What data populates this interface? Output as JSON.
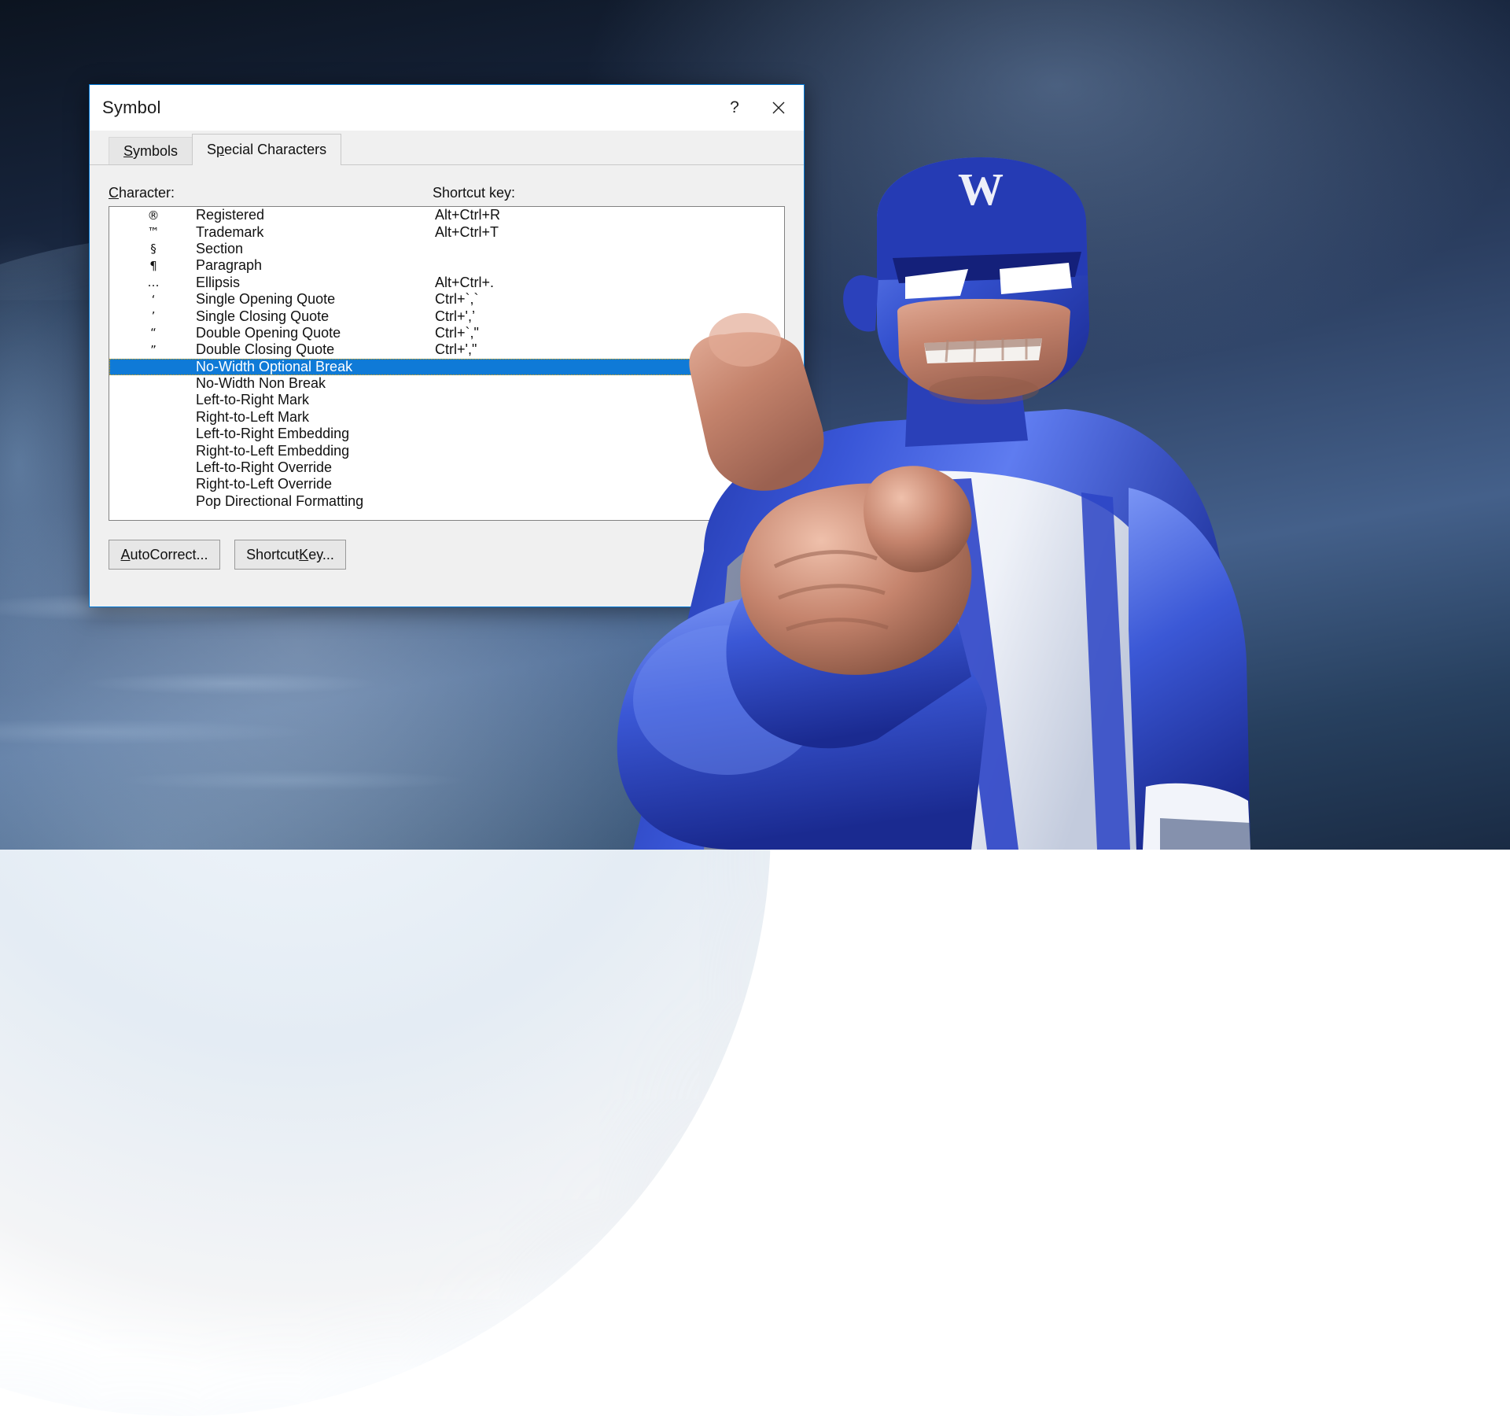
{
  "window": {
    "title": "Symbol",
    "help_label": "?",
    "close_label": "✕"
  },
  "tabs": [
    {
      "id": "symbols",
      "label": "Symbols",
      "accel": "S",
      "active": false
    },
    {
      "id": "special-characters",
      "label": "Special Characters",
      "accel": "p",
      "active": true
    }
  ],
  "headers": {
    "character": "Character:",
    "character_accel": "C",
    "shortcut_key": "Shortcut key:"
  },
  "list": {
    "selected_index": 9,
    "rows": [
      {
        "symbol": "®",
        "name": "Registered",
        "shortcut": "Alt+Ctrl+R"
      },
      {
        "symbol": "™",
        "name": "Trademark",
        "shortcut": "Alt+Ctrl+T"
      },
      {
        "symbol": "§",
        "name": "Section",
        "shortcut": ""
      },
      {
        "symbol": "¶",
        "name": "Paragraph",
        "shortcut": ""
      },
      {
        "symbol": "…",
        "name": "Ellipsis",
        "shortcut": "Alt+Ctrl+."
      },
      {
        "symbol": "‘",
        "name": "Single Opening Quote",
        "shortcut": "Ctrl+`,`"
      },
      {
        "symbol": "’",
        "name": "Single Closing Quote",
        "shortcut": "Ctrl+',’"
      },
      {
        "symbol": "“",
        "name": "Double Opening Quote",
        "shortcut": "Ctrl+`,\""
      },
      {
        "symbol": "”",
        "name": "Double Closing Quote",
        "shortcut": "Ctrl+',\""
      },
      {
        "symbol": "",
        "name": "No-Width Optional Break",
        "shortcut": ""
      },
      {
        "symbol": "",
        "name": "No-Width Non Break",
        "shortcut": ""
      },
      {
        "symbol": "",
        "name": "Left-to-Right Mark",
        "shortcut": ""
      },
      {
        "symbol": "",
        "name": "Right-to-Left Mark",
        "shortcut": ""
      },
      {
        "symbol": "",
        "name": "Left-to-Right Embedding",
        "shortcut": ""
      },
      {
        "symbol": "",
        "name": "Right-to-Left Embedding",
        "shortcut": ""
      },
      {
        "symbol": "",
        "name": "Left-to-Right Override",
        "shortcut": ""
      },
      {
        "symbol": "",
        "name": "Right-to-Left Override",
        "shortcut": ""
      },
      {
        "symbol": "",
        "name": "Pop Directional Formatting",
        "shortcut": ""
      }
    ]
  },
  "buttons": [
    {
      "id": "autocorrect",
      "label": "AutoCorrect...",
      "accel": "A"
    },
    {
      "id": "shortcut-key",
      "label": "Shortcut Key...",
      "accel": "K"
    }
  ],
  "mascot": {
    "logo_letter": "W"
  },
  "colors": {
    "selection_blue": "#0f7ad7",
    "window_border": "#0078d7",
    "dialog_face": "#f0f0f0",
    "focus_outline": "#f0a500",
    "mascot_blue": "#2b44c8",
    "mascot_skin": "#c98b73"
  }
}
